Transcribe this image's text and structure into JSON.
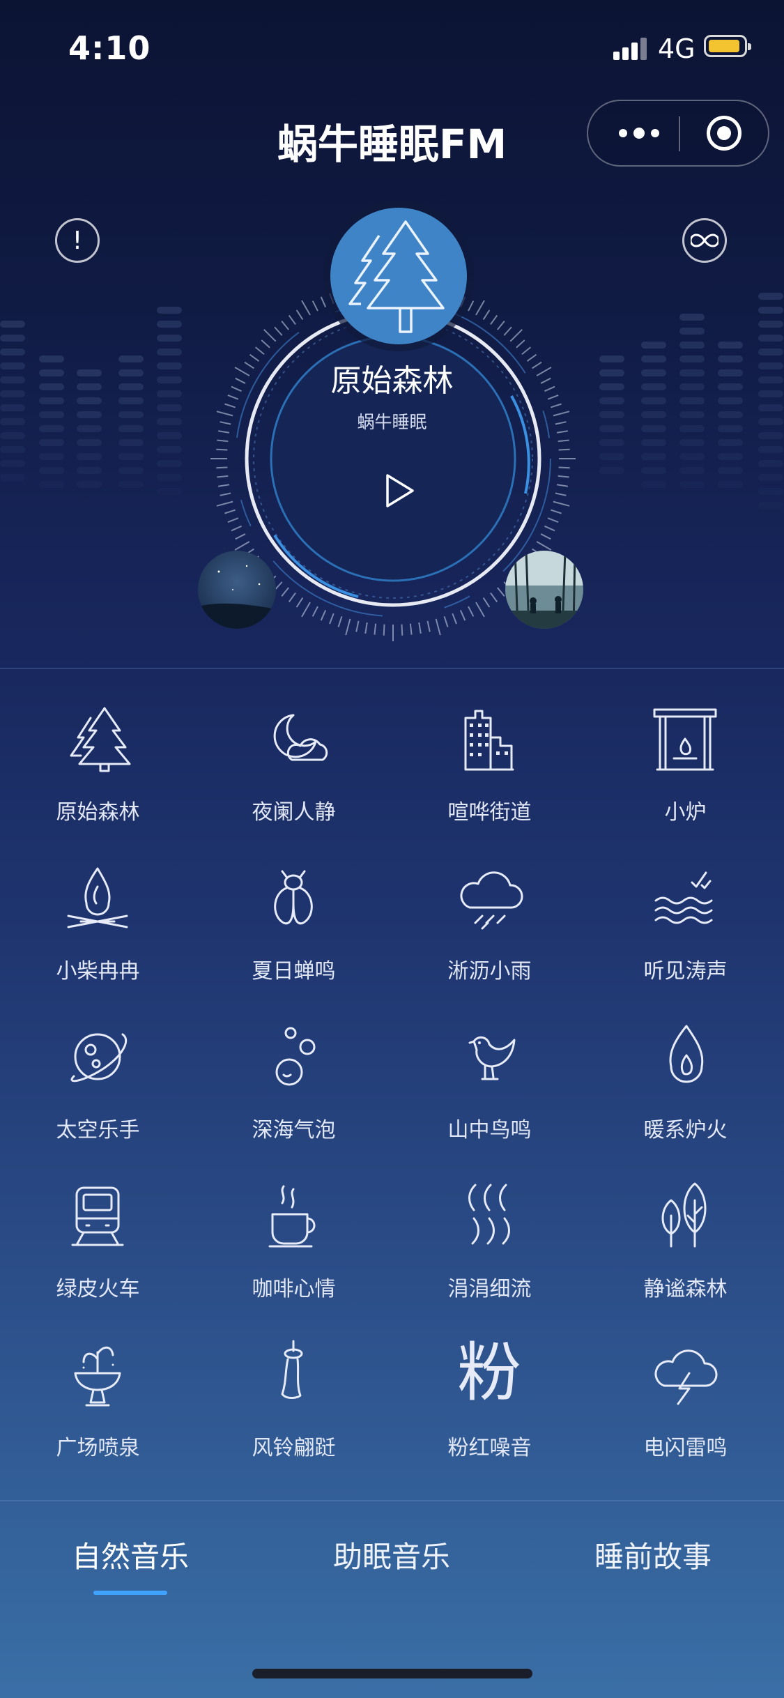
{
  "status_bar": {
    "time": "4:10",
    "network": "4G"
  },
  "header": {
    "title": "蜗牛睡眠FM"
  },
  "player": {
    "track_name": "原始森林",
    "subtitle": "蜗牛睡眠"
  },
  "sounds": [
    {
      "label": "原始森林",
      "icon": "pine-tree-icon"
    },
    {
      "label": "夜阑人静",
      "icon": "moon-cloud-icon"
    },
    {
      "label": "喧哗街道",
      "icon": "city-building-icon"
    },
    {
      "label": "小炉",
      "icon": "fireplace-icon"
    },
    {
      "label": "小柴冉冉",
      "icon": "campfire-icon"
    },
    {
      "label": "夏日蝉鸣",
      "icon": "cicada-icon"
    },
    {
      "label": "淅沥小雨",
      "icon": "rain-cloud-icon"
    },
    {
      "label": "听见涛声",
      "icon": "waves-icon"
    },
    {
      "label": "太空乐手",
      "icon": "planet-icon"
    },
    {
      "label": "深海气泡",
      "icon": "bubbles-icon"
    },
    {
      "label": "山中鸟鸣",
      "icon": "bird-icon"
    },
    {
      "label": "暖系炉火",
      "icon": "flame-icon"
    },
    {
      "label": "绿皮火车",
      "icon": "train-icon"
    },
    {
      "label": "咖啡心情",
      "icon": "coffee-cup-icon"
    },
    {
      "label": "涓涓细流",
      "icon": "stream-icon"
    },
    {
      "label": "静谧森林",
      "icon": "trees-icon"
    },
    {
      "label": "广场喷泉",
      "icon": "fountain-icon"
    },
    {
      "label": "风铃翩跹",
      "icon": "wind-chime-icon"
    },
    {
      "label": "粉红噪音",
      "icon": "pink-noise-icon",
      "glyph": "粉"
    },
    {
      "label": "电闪雷鸣",
      "icon": "thunder-cloud-icon"
    }
  ],
  "tabs": [
    {
      "label": "自然音乐",
      "active": true
    },
    {
      "label": "助眠音乐",
      "active": false
    },
    {
      "label": "睡前故事",
      "active": false
    }
  ],
  "colors": {
    "accent": "#3fa3ff",
    "cover_bg": "#3f84c6",
    "battery": "#f4c430"
  }
}
